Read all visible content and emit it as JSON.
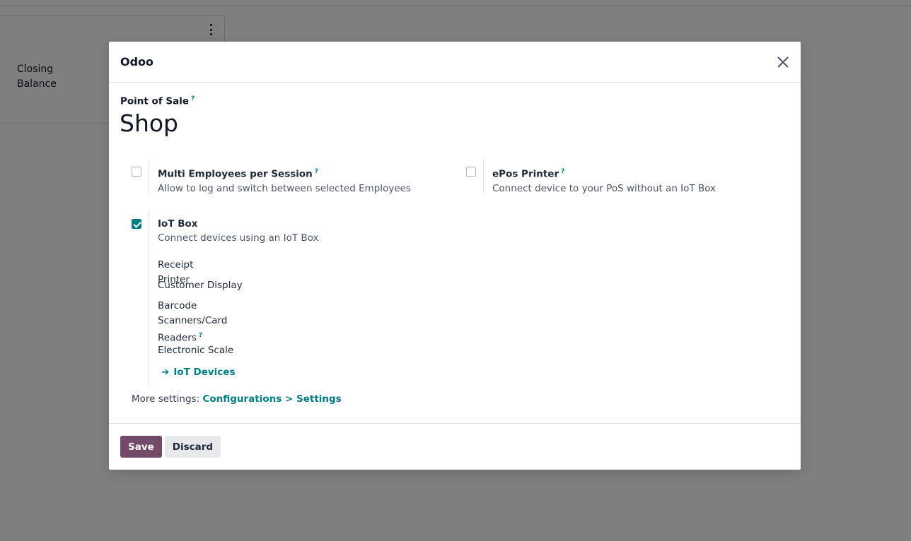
{
  "background": {
    "closing_balance_label": "Closing Balance"
  },
  "dialog": {
    "title": "Odoo",
    "field_label": "Point of Sale",
    "help_mark": "?",
    "pos_name": "Shop",
    "settings": {
      "multi_employees": {
        "title": "Multi Employees per Session",
        "description": "Allow to log and switch between selected Employees",
        "checked": false
      },
      "epos_printer": {
        "title": "ePos Printer",
        "description": "Connect device to your PoS without an IoT Box",
        "checked": false
      },
      "iot_box": {
        "title": "IoT Box",
        "description": "Connect devices using an IoT Box",
        "checked": true,
        "devices": {
          "receipt_printer": "Receipt Printer",
          "customer_display": "Customer Display",
          "barcode_1": "Barcode",
          "barcode_2": "Scanners/Card",
          "barcode_3": "Readers",
          "electronic_scale": "Electronic Scale"
        },
        "link_label": "IoT Devices"
      }
    },
    "more_settings_prefix": "More settings: ",
    "more_settings_link": "Configurations > Settings",
    "buttons": {
      "save": "Save",
      "discard": "Discard"
    }
  },
  "colors": {
    "primary": "#714b67",
    "accent": "#017e84"
  }
}
